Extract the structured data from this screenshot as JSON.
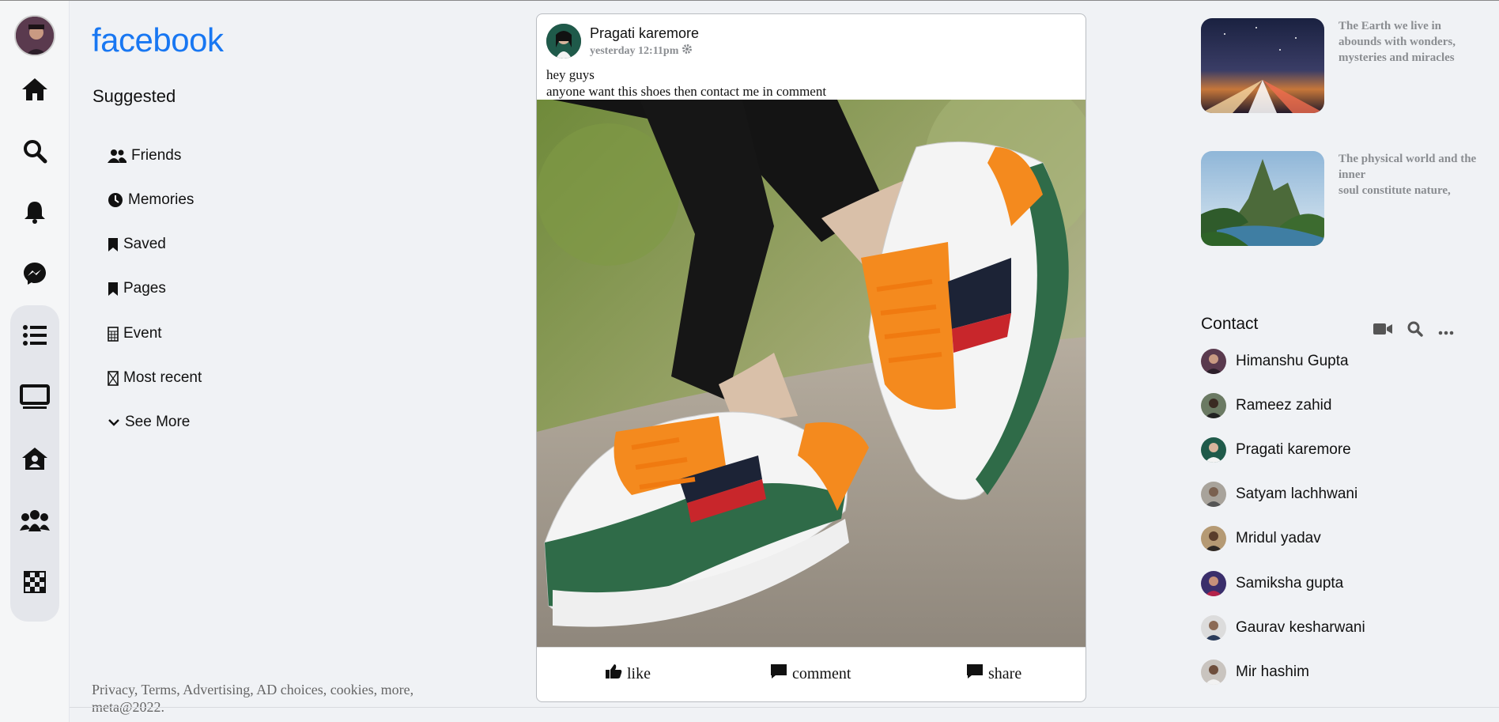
{
  "app": {
    "logo": "facebook"
  },
  "rail": {
    "icons": [
      "profile-avatar",
      "home-icon",
      "search-icon",
      "bell-icon",
      "messenger-icon",
      "list-icon",
      "monitor-icon",
      "house-user-icon",
      "people-group-icon",
      "checkerboard-icon"
    ]
  },
  "sidebar": {
    "heading": "Suggested",
    "items": [
      {
        "label": "Friends",
        "icon": "user-friends-icon"
      },
      {
        "label": "Memories",
        "icon": "clock-icon"
      },
      {
        "label": "Saved",
        "icon": "bookmark-icon"
      },
      {
        "label": "Pages",
        "icon": "bookmark-icon"
      },
      {
        "label": "Event",
        "icon": "calendar-icon"
      },
      {
        "label": "Most recent",
        "icon": "box-icon"
      },
      {
        "label": "See More",
        "icon": "chevron-down-icon"
      }
    ],
    "footer": "Privacy, Terms, Advertising, AD choices, cookies, more, meta@2022."
  },
  "post": {
    "author": "Pragati karemore",
    "time": "yesterday 12:11pm",
    "text_line1": "hey guys",
    "text_line2": "anyone want this shoes then contact me in comment",
    "actions": {
      "like": "like",
      "comment": "comment",
      "share": "share"
    }
  },
  "stories": [
    {
      "text": "The Earth we live in abounds with wonders, mysteries and miracles"
    },
    {
      "text_line1": "The physical world and the inner",
      "text_line2": "soul constitute nature,"
    }
  ],
  "contacts": {
    "title": "Contact",
    "people": [
      "Himanshu Gupta",
      "Rameez zahid",
      "Pragati karemore",
      "Satyam lachhwani",
      "Mridul yadav",
      "Samiksha gupta",
      "Gaurav kesharwani",
      "Mir hashim"
    ]
  },
  "colors": {
    "brand": "#1877f2",
    "background": "#f0f2f5",
    "muted": "#8a8d91"
  }
}
